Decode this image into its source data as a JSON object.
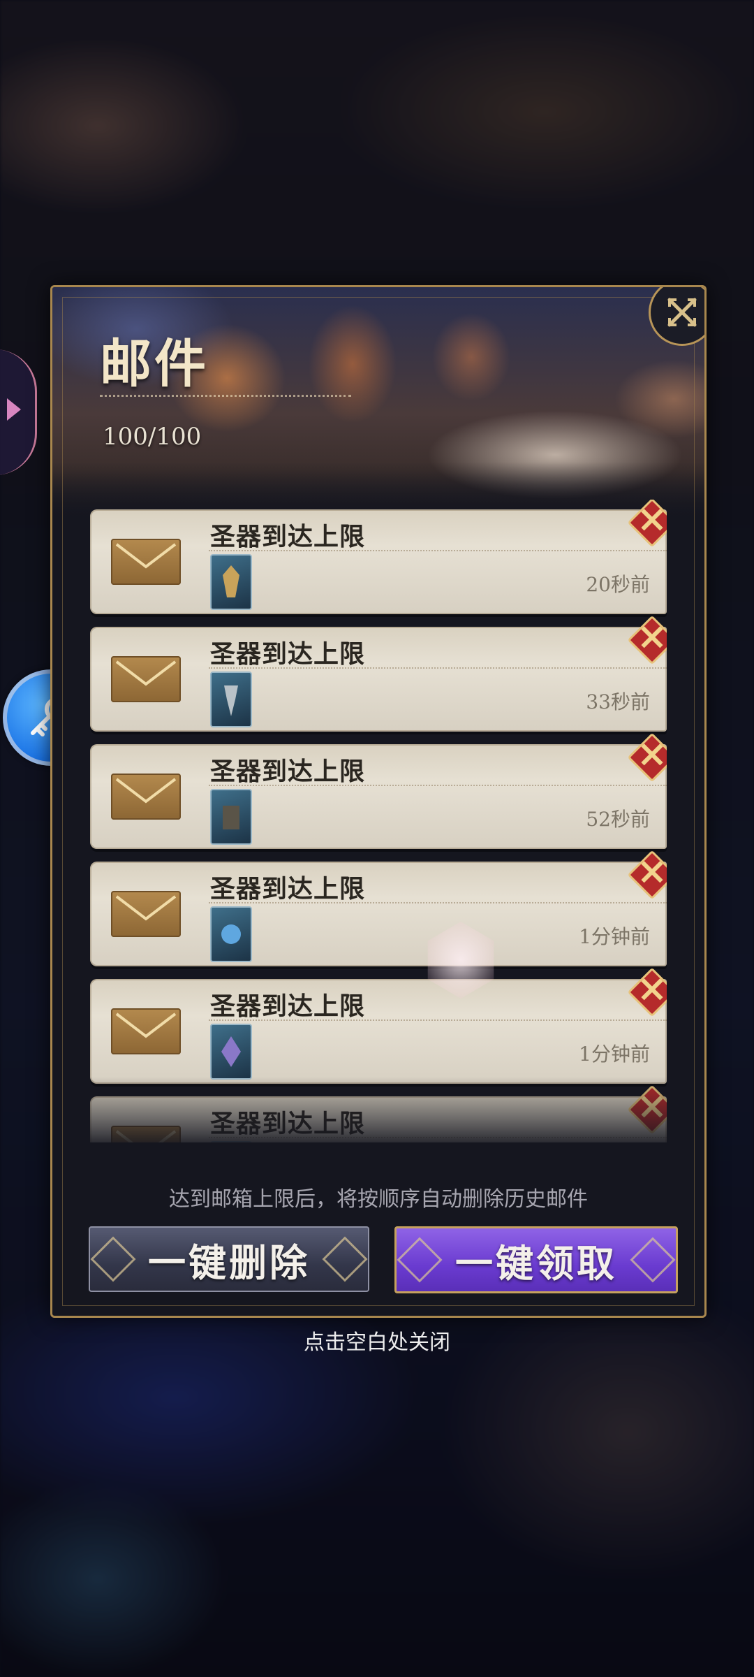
{
  "mail_panel": {
    "title": "邮件",
    "count": "100/100",
    "close_icon": "close-x-icon",
    "mails": [
      {
        "title": "圣器到达上限",
        "time": "20秒前",
        "reward_icon": "gift-icon"
      },
      {
        "title": "圣器到达上限",
        "time": "33秒前",
        "reward_icon": "gift-icon"
      },
      {
        "title": "圣器到达上限",
        "time": "52秒前",
        "reward_icon": "gift-icon"
      },
      {
        "title": "圣器到达上限",
        "time": "1分钟前",
        "reward_icon": "gift-icon"
      },
      {
        "title": "圣器到达上限",
        "time": "1分钟前",
        "reward_icon": "gift-icon"
      },
      {
        "title": "圣器到达上限",
        "time": "",
        "reward_icon": "gift-icon"
      }
    ],
    "notice": "达到邮箱上限后，将按顺序自动删除历史邮件",
    "delete_all_label": "一键删除",
    "claim_all_label": "一键领取"
  },
  "close_hint": "点击空白处关闭",
  "colors": {
    "panel_border": "#a8874e",
    "claim_button": "#6a3bd0",
    "delete_button": "#3a3d52",
    "assistive_button": "#1b74e6"
  }
}
